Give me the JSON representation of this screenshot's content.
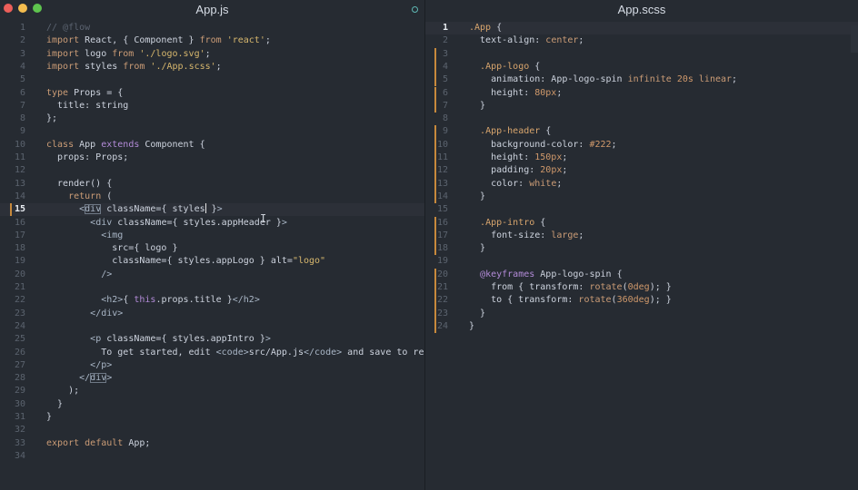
{
  "window": {
    "traffic_lights": {
      "close_color": "#ec5f5a",
      "minimize_color": "#f4bd4f",
      "maximize_color": "#5ec44e"
    }
  },
  "left_pane": {
    "title": "App.js",
    "active_line": 15,
    "lines": [
      "// @flow",
      "import React, { Component } from 'react';",
      "import logo from './logo.svg';",
      "import styles from './App.scss';",
      "",
      "type Props = {",
      "  title: string",
      "};",
      "",
      "class App extends Component {",
      "  props: Props;",
      "",
      "  render() {",
      "    return (",
      "      <div className={ styles }>",
      "        <div className={ styles.appHeader }>",
      "          <img",
      "            src={ logo }",
      "            className={ styles.appLogo } alt=\"logo\"",
      "          />",
      "",
      "          <h2>{ this.props.title }</h2>",
      "        </div>",
      "",
      "        <p className={ styles.appIntro }>",
      "          To get started, edit <code>src/App.js</code> and save to reload",
      "        </p>",
      "      </div>",
      "    );",
      "  }",
      "}",
      "",
      "export default App;",
      ""
    ]
  },
  "right_pane": {
    "title": "App.scss",
    "active_line": 1,
    "modified_line_ranges": [
      [
        3,
        7
      ],
      [
        9,
        14
      ],
      [
        16,
        18
      ],
      [
        20,
        24
      ]
    ],
    "lines": [
      ".App {",
      "  text-align: center;",
      "",
      "  .App-logo {",
      "    animation: App-logo-spin infinite 20s linear;",
      "    height: 80px;",
      "  }",
      "",
      "  .App-header {",
      "    background-color: #222;",
      "    height: 150px;",
      "    padding: 20px;",
      "    color: white;",
      "  }",
      "",
      "  .App-intro {",
      "    font-size: large;",
      "  }",
      "",
      "  @keyframes App-logo-spin {",
      "    from { transform: rotate(0deg); }",
      "    to { transform: rotate(360deg); }",
      "  }",
      "}"
    ]
  },
  "colors": {
    "background": "#262b32",
    "keyword": "#cb9c76",
    "string": "#d7b76d",
    "comment": "#5b6370",
    "gutter_modified": "#c7893c"
  }
}
